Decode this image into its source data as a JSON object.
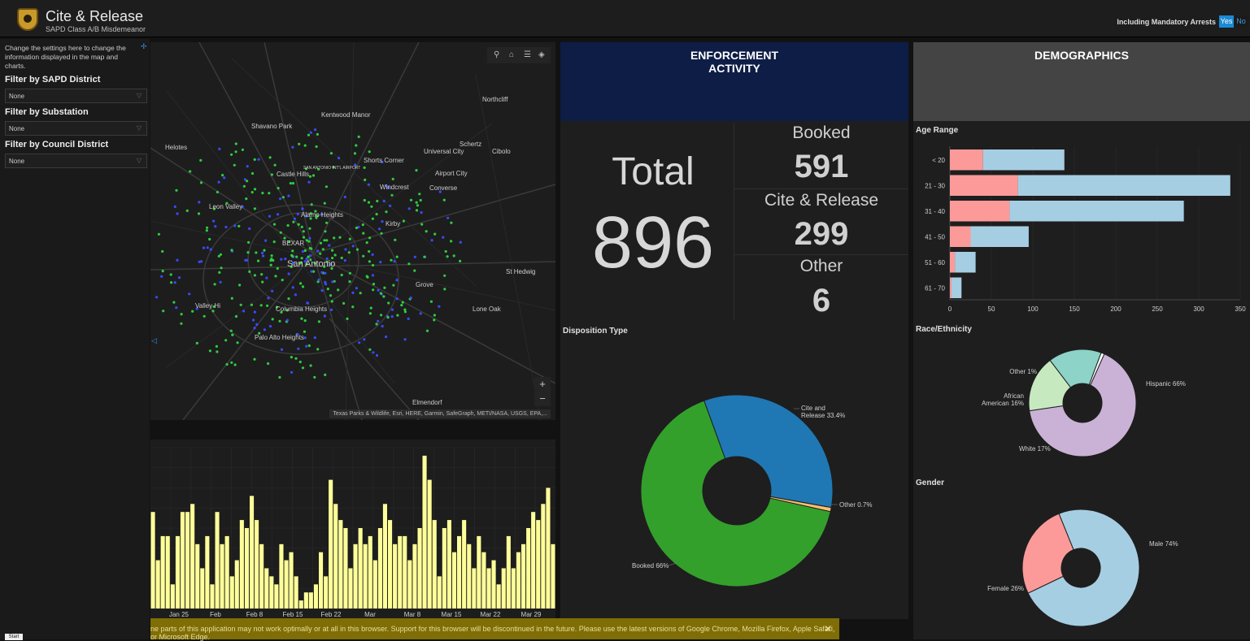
{
  "header": {
    "title": "Cite & Release",
    "subtitle": "SAPD Class A/B Misdemeanor",
    "toggle_label": "Including Mandatory Arrests",
    "toggle_yes": "Yes",
    "toggle_no": "No"
  },
  "sidebar": {
    "help": "Change the settings here to change the information displayed in the map and charts.",
    "filters": [
      {
        "label": "Filter by SAPD District",
        "value": "None"
      },
      {
        "label": "Filter by Substation",
        "value": "None"
      },
      {
        "label": "Filter by Council District",
        "value": "None"
      }
    ],
    "stat_button": "Start"
  },
  "map": {
    "attribution": "Texas Parks & Wildlife, Esri, HERE, Garmin, SafeGraph, METI/NASA, USGS, EPA,...",
    "zoom_in": "+",
    "zoom_out": "−",
    "places": [
      "Northcliff",
      "Kentwood Manor",
      "Shavano Park",
      "Schertz",
      "Cibolo",
      "Helotes",
      "Universal City",
      "Shorts Corner",
      "Castle Hills",
      "SAN ANTONIO INT'L AIRPORT",
      "Airport City",
      "Windcrest",
      "Converse",
      "Leon Valley",
      "Alamo Heights",
      "Kirby",
      "BEXAR",
      "San Antonio",
      "St Hedwig",
      "Grove",
      "Valley Hi",
      "Columbia Heights",
      "Lone Oak",
      "Palo Alto Heights",
      "Elmendorf"
    ]
  },
  "timeline": {
    "x_labels": [
      "Jan 25",
      "Feb",
      "Feb 8",
      "Feb 15",
      "Feb 22",
      "Mar",
      "Mar 8",
      "Mar 15",
      "Mar 22",
      "Mar 29"
    ]
  },
  "enforcement": {
    "title_line1": "ENFORCEMENT",
    "title_line2": "ACTIVITY",
    "total_label": "Total",
    "total_value": "896",
    "booked_label": "Booked",
    "booked_value": "591",
    "cite_label": "Cite & Release",
    "cite_value": "299",
    "other_label": "Other",
    "other_value": "6",
    "disposition_title": "Disposition Type"
  },
  "demographics": {
    "title": "DEMOGRAPHICS",
    "age_title": "Age Range",
    "race_title": "Race/Ethnicity",
    "gender_title": "Gender"
  },
  "notice": {
    "text": "ne parts of this application may not work optimally or at all in this browser. Support for this browser will be discontinued in the future. Please use the latest versions of Google Chrome, Mozilla Firefox, Apple Safari, or Microsoft Edge.",
    "close": "✕"
  },
  "colors": {
    "booked": "#33a02c",
    "cite": "#1f78b4",
    "other": "#fdbf6f",
    "bar_yellow": "#ffff99",
    "age_left": "#fb9a99",
    "age_right": "#a6cee3"
  },
  "chart_data": [
    {
      "type": "bar",
      "title": "",
      "categories": [
        "b1",
        "b2",
        "b3",
        "b4",
        "b5",
        "b6",
        "b7",
        "b8",
        "b9",
        "b10",
        "b11",
        "b12",
        "b13",
        "b14",
        "b15",
        "b16",
        "b17",
        "b18",
        "b19",
        "b20",
        "b21",
        "b22",
        "b23",
        "b24",
        "b25",
        "b26",
        "b27",
        "b28",
        "b29",
        "b30",
        "b31",
        "b32",
        "b33",
        "b34",
        "b35",
        "b36",
        "b37",
        "b38",
        "b39",
        "b40",
        "b41",
        "b42",
        "b43",
        "b44",
        "b45",
        "b46",
        "b47",
        "b48",
        "b49",
        "b50",
        "b51",
        "b52",
        "b53",
        "b54",
        "b55",
        "b56",
        "b57",
        "b58",
        "b59",
        "b60",
        "b61",
        "b62",
        "b63",
        "b64",
        "b65",
        "b66",
        "b67",
        "b68",
        "b69",
        "b70",
        "b71",
        "b72",
        "b73",
        "b74",
        "b75",
        "b76",
        "b77",
        "b78",
        "b79",
        "b80",
        "b81",
        "b82"
      ],
      "values": [
        12,
        6,
        9,
        9,
        3,
        9,
        12,
        12,
        13,
        8,
        5,
        9,
        3,
        12,
        8,
        9,
        4,
        6,
        11,
        10,
        14,
        11,
        8,
        5,
        4,
        3,
        8,
        6,
        7,
        4,
        1,
        2,
        2,
        3,
        7,
        4,
        16,
        13,
        11,
        10,
        5,
        8,
        10,
        8,
        9,
        6,
        10,
        13,
        11,
        8,
        9,
        9,
        6,
        8,
        10,
        19,
        16,
        11,
        4,
        10,
        11,
        7,
        9,
        11,
        8,
        5,
        9,
        7,
        5,
        6,
        3,
        5,
        9,
        5,
        7,
        8,
        10,
        12,
        11,
        13,
        15,
        8
      ],
      "ylim": [
        0,
        20
      ]
    },
    {
      "type": "pie",
      "title": "Disposition Type",
      "labels": [
        "Cite and Release 33.4%",
        "Other 0.7%",
        "Booked 66%"
      ],
      "values": [
        33.4,
        0.7,
        66
      ]
    },
    {
      "type": "bar",
      "title": "Age Range",
      "categories": [
        "< 20",
        "21 - 30",
        "31 - 40",
        "41 - 50",
        "51 - 60",
        "61 - 70"
      ],
      "series": [
        {
          "values": [
            40,
            82,
            72,
            25,
            6,
            2
          ]
        },
        {
          "values": [
            98,
            256,
            210,
            70,
            25,
            12
          ]
        }
      ],
      "xlim": [
        0,
        350
      ],
      "x_ticks": [
        0,
        50,
        100,
        150,
        200,
        250,
        300,
        350
      ]
    },
    {
      "type": "pie",
      "title": "Race/Ethnicity",
      "labels": [
        "Hispanic 66%",
        "White 17%",
        "African American 16%",
        "Other 1%"
      ],
      "values": [
        66,
        17,
        16,
        1
      ]
    },
    {
      "type": "pie",
      "title": "Gender",
      "labels": [
        "Male 74%",
        "Female 26%"
      ],
      "values": [
        74,
        26
      ]
    }
  ]
}
